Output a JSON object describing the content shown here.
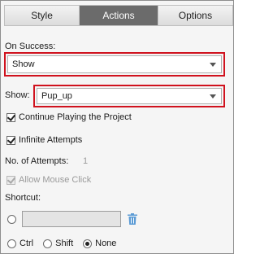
{
  "tabs": [
    {
      "label": "Style",
      "active": false
    },
    {
      "label": "Actions",
      "active": true
    },
    {
      "label": "Options",
      "active": false
    }
  ],
  "on_success": {
    "label": "On Success:",
    "value": "Show"
  },
  "show": {
    "label": "Show:",
    "value": "Pup_up"
  },
  "checkboxes": {
    "continue_playing": {
      "label": "Continue Playing the Project",
      "checked": true
    },
    "infinite_attempts": {
      "label": "Infinite Attempts",
      "checked": true
    },
    "allow_mouse_click": {
      "label": "Allow Mouse Click",
      "checked": true,
      "disabled": true
    }
  },
  "attempts": {
    "label": "No. of Attempts:",
    "value": "1"
  },
  "shortcut": {
    "label": "Shortcut:",
    "value": ""
  },
  "modifiers": {
    "ctrl": "Ctrl",
    "shift": "Shift",
    "none": "None",
    "selected": "None"
  },
  "icons": {
    "dropdown": "chevron-down-icon",
    "trash": "trash-icon"
  },
  "colors": {
    "highlight_border": "#d0121e",
    "active_tab": "#6b6b6b",
    "trash_icon": "#5b9bd5"
  }
}
